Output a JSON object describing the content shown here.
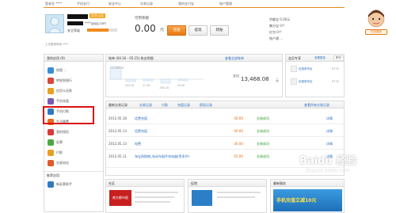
{
  "tabs": [
    "登录名 ****",
    "手机支付",
    "安全中心",
    "交易记录",
    "我的支付宝",
    "账户管理"
  ],
  "account": {
    "masked_name": "****",
    "badge": "实名认证",
    "email": "****@qq.com",
    "security_label": "安全等级",
    "last_login": "上次登录时间 ****",
    "balance_label": "可用余额",
    "balance": "0.00",
    "unit": "元",
    "buttons": [
      "充值",
      "提现",
      "转账"
    ],
    "right_links": [
      "余额宝 0.00元",
      "集分宝 0个",
      "红包 0个",
      "账户通 ..."
    ]
  },
  "assistant": {
    "label": "在线客服"
  },
  "sidebar": {
    "header": "我的应用 (9)",
    "items": [
      "地图 ...",
      "转账到银行",
      "信用卡还款",
      "手机充值",
      "手机付款",
      "生活缴费",
      "我的保险",
      "彩票",
      "付款",
      "交易协议"
    ],
    "bottom_header": "推荐应用",
    "bottom_item": "新彩票助手"
  },
  "bill": {
    "title": "账单 (04.16 - 05.15) 收支明细",
    "link": "查看全部账单",
    "chart_labels": [
      "-11,286.59",
      "-203.20",
      "-11.30",
      "-500.10",
      "-25.00"
    ],
    "total_label": "支出",
    "total": "13,468.08",
    "unit": "元"
  },
  "right_panel": {
    "title": "会员专享",
    "link": "查看更多",
    "tab": "积分",
    "items": [
      {
        "name": "优惠券专区",
        "value": "8770"
      },
      {
        "name": "优惠券专区",
        "value": "8770"
      }
    ]
  },
  "records": {
    "title": "最新交易记录",
    "tabs": [
      "交易记录",
      "付款",
      "充值记录",
      "提现记录"
    ],
    "link": "查看所有交易记录",
    "rows": [
      {
        "date": "2012.05.18",
        "name": "话费充值",
        "amount": "-50.00",
        "status": "交易成功",
        "action": "详情"
      },
      {
        "date": "2012.05.13",
        "name": "话费充值",
        "amount": "-50.00",
        "status": "交易成功",
        "action": "详情"
      },
      {
        "date": "2012.05.13",
        "name": "电费",
        "amount": "-30.00",
        "status": "交易成功",
        "action": "详情"
      },
      {
        "date": "2012.05.11",
        "name": "淘宝网购物_电动车配件充电器(等多件)",
        "amount": "-55.00",
        "status": "交易成功",
        "action": "详情"
      }
    ]
  },
  "bottom": {
    "community": "社区",
    "promotion": "促销",
    "latest": "最新服务",
    "brand_text": "南方都市报",
    "banner": "手机充值立减10元",
    "watermark": "Baidu 经验",
    "watermark_url": "jingyan.baidu.com"
  },
  "colors": {
    "accent": "#e8640c",
    "highlight_box": "#dd1111",
    "button_orange": "#f08c1e"
  }
}
